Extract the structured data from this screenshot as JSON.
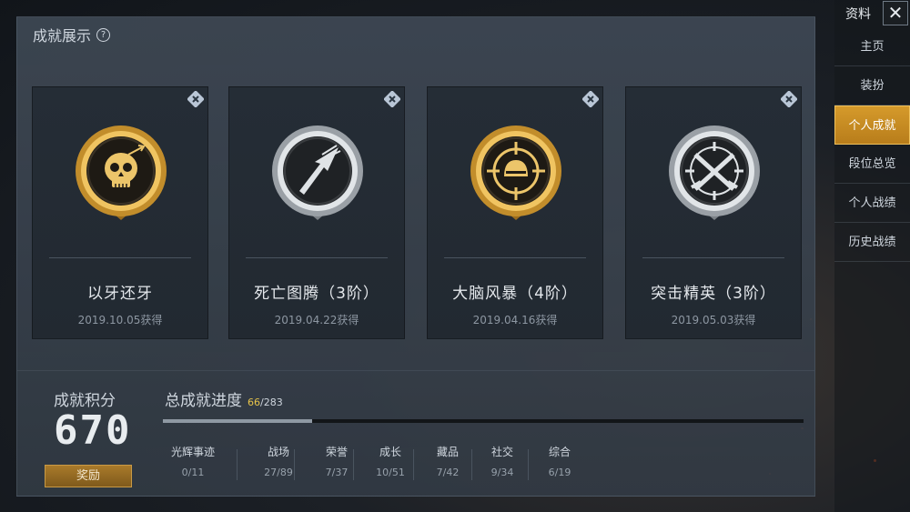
{
  "panel": {
    "title": "成就展示",
    "help_icon": "question-circle-icon"
  },
  "cards": [
    {
      "name": "以牙还牙",
      "date": "2019.10.05获得",
      "tier": "gold",
      "emblem": "skull-icon"
    },
    {
      "name": "死亡图腾（3阶）",
      "date": "2019.04.22获得",
      "tier": "silver",
      "emblem": "arrowhead-icon"
    },
    {
      "name": "大脑风暴（4阶）",
      "date": "2019.04.16获得",
      "tier": "gold",
      "emblem": "helmet-crosshair-icon"
    },
    {
      "name": "突击精英（3阶）",
      "date": "2019.05.03获得",
      "tier": "silver",
      "emblem": "crossed-rifles-icon"
    }
  ],
  "score": {
    "label": "成就积分",
    "value": "670",
    "reward_label": "奖励"
  },
  "progress": {
    "title": "总成就进度",
    "current": "66",
    "total": "/283",
    "fraction": 0.233,
    "categories": [
      {
        "label": "光辉事迹",
        "value": "0/11"
      },
      {
        "label": "战场",
        "value": "27/89"
      },
      {
        "label": "荣誉",
        "value": "7/37"
      },
      {
        "label": "成长",
        "value": "10/51"
      },
      {
        "label": "藏品",
        "value": "7/42"
      },
      {
        "label": "社交",
        "value": "9/34"
      },
      {
        "label": "综合",
        "value": "6/19"
      }
    ]
  },
  "sidebar": {
    "title": "资料",
    "close_icon": "close-icon",
    "items": [
      {
        "label": "主页",
        "active": false
      },
      {
        "label": "装扮",
        "active": false
      },
      {
        "label": "个人成就",
        "active": true
      },
      {
        "label": "段位总览",
        "active": false
      },
      {
        "label": "个人战绩",
        "active": false
      },
      {
        "label": "历史战绩",
        "active": false
      }
    ]
  },
  "colors": {
    "gold": "#d4a23a",
    "silver": "#b9bec4",
    "accent": "#d59a2b"
  }
}
